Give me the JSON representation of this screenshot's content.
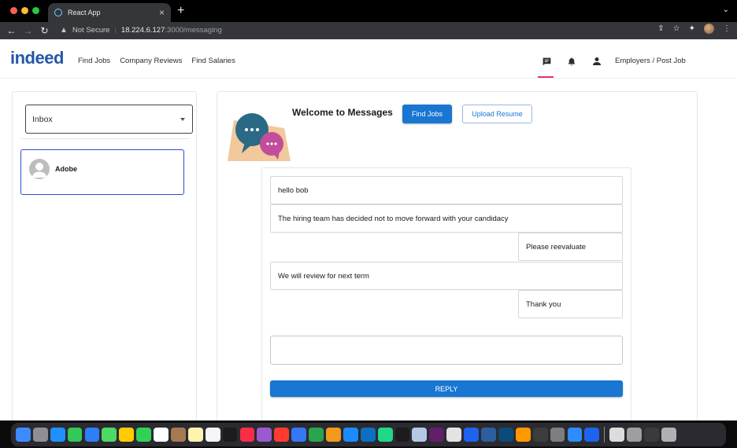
{
  "browser": {
    "tab_title": "React App",
    "security_label": "Not Secure",
    "url_host": "18.224.6.127",
    "url_path": ":3000/messaging"
  },
  "header": {
    "logo": "indeed",
    "nav": [
      "Find Jobs",
      "Company Reviews",
      "Find Salaries"
    ],
    "employers_link": "Employers / Post Job"
  },
  "sidebar": {
    "inbox_selected": "Inbox",
    "conversations": [
      {
        "name": "Adobe"
      }
    ]
  },
  "main": {
    "welcome_title": "Welcome to Messages",
    "find_jobs_label": "Find Jobs",
    "upload_resume_label": "Upload Resume",
    "messages": [
      {
        "text": "hello bob",
        "side": "left"
      },
      {
        "text": "The hiring team has decided not to move forward with your candidacy",
        "side": "left"
      },
      {
        "text": "Please reevaluate",
        "side": "right"
      },
      {
        "text": "We will review for next term",
        "side": "left"
      },
      {
        "text": "Thank you",
        "side": "right"
      }
    ],
    "reply_value": "",
    "reply_label": "REPLY"
  },
  "colors": {
    "primary": "#1976d2",
    "indeed_blue": "#2557a7",
    "active_tab_accent": "#e2336b",
    "selected_conversation_border": "#2d4bd1"
  },
  "dock_apps": [
    "finder",
    "launchpad",
    "safari",
    "messages",
    "mail",
    "maps",
    "photos",
    "facetime",
    "calendar",
    "contacts",
    "notes",
    "reminders",
    "apple-tv",
    "music",
    "podcasts",
    "news",
    "keynote",
    "numbers",
    "pages",
    "app-store",
    "vscode",
    "pycharm",
    "terminal",
    "preview",
    "slack",
    "chrome",
    "docker",
    "sourcetree",
    "cyberduck",
    "sublime",
    "istat",
    "quicktime",
    "zoom",
    "docker-desktop",
    "finder-doc",
    "system-settings",
    "screens",
    "trash"
  ]
}
